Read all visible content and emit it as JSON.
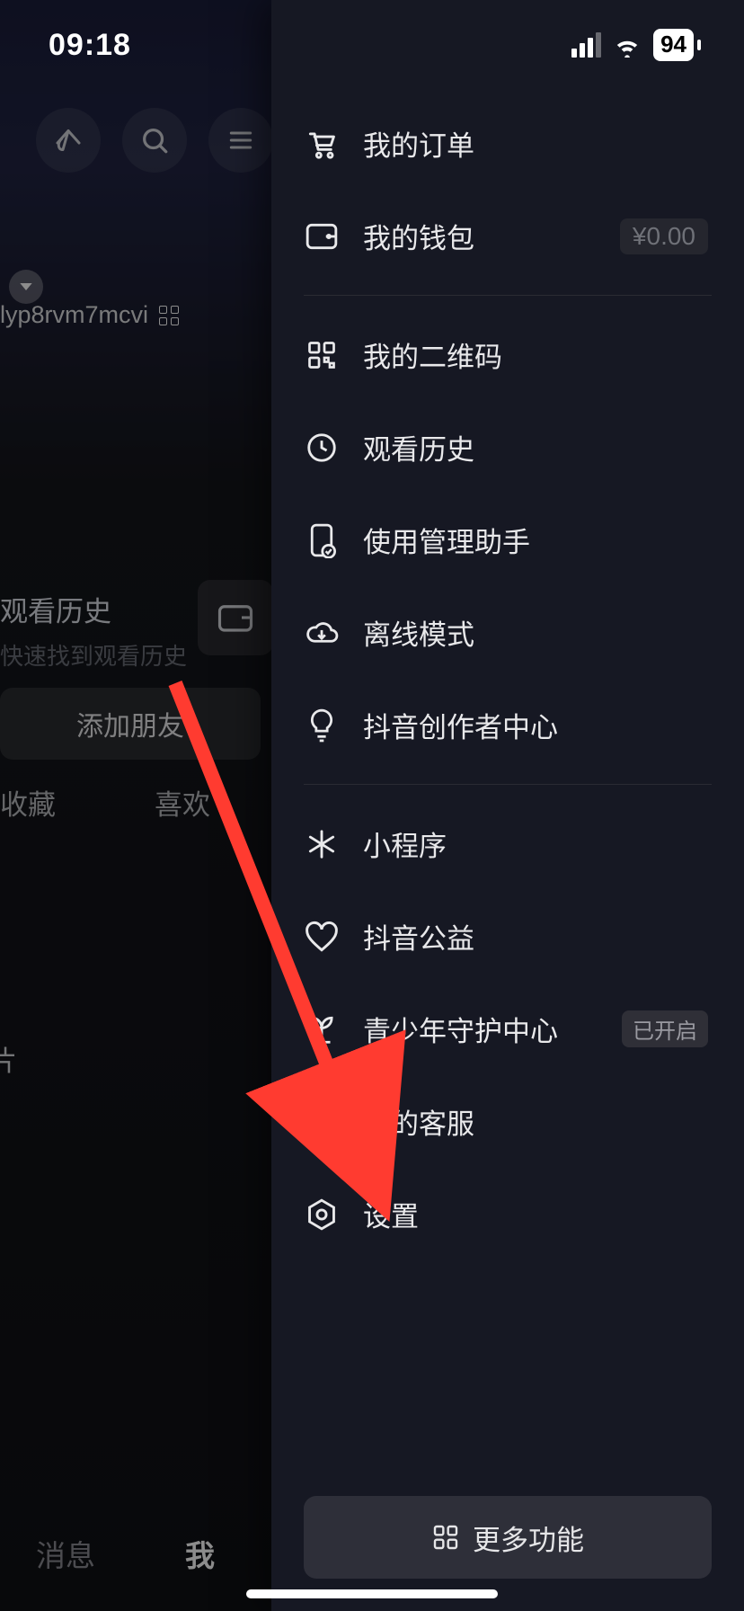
{
  "statusbar": {
    "time": "09:18",
    "battery": "94"
  },
  "background": {
    "user_id": "lyp8rvm7mcvi",
    "watch_title": "观看历史",
    "watch_sub": "快速找到观看历史",
    "add_friend": "添加朋友",
    "tab_collect": "收藏",
    "tab_like": "喜欢",
    "pian": "片",
    "bottom_msg": "消息",
    "bottom_me": "我"
  },
  "drawer": {
    "items": [
      {
        "icon": "cart",
        "label": "我的订单"
      },
      {
        "icon": "wallet",
        "label": "我的钱包",
        "right": "¥0.00"
      },
      {
        "icon": "qr",
        "label": "我的二维码"
      },
      {
        "icon": "clock",
        "label": "观看历史"
      },
      {
        "icon": "phone-check",
        "label": "使用管理助手"
      },
      {
        "icon": "cloud-down",
        "label": "离线模式"
      },
      {
        "icon": "bulb",
        "label": "抖音创作者中心"
      },
      {
        "icon": "spark",
        "label": "小程序"
      },
      {
        "icon": "heart",
        "label": "抖音公益"
      },
      {
        "icon": "sprout",
        "label": "青少年守护中心",
        "badge": "已开启"
      },
      {
        "icon": "headset",
        "label": "我的客服"
      },
      {
        "icon": "gear",
        "label": "设置"
      }
    ],
    "more": "更多功能"
  }
}
